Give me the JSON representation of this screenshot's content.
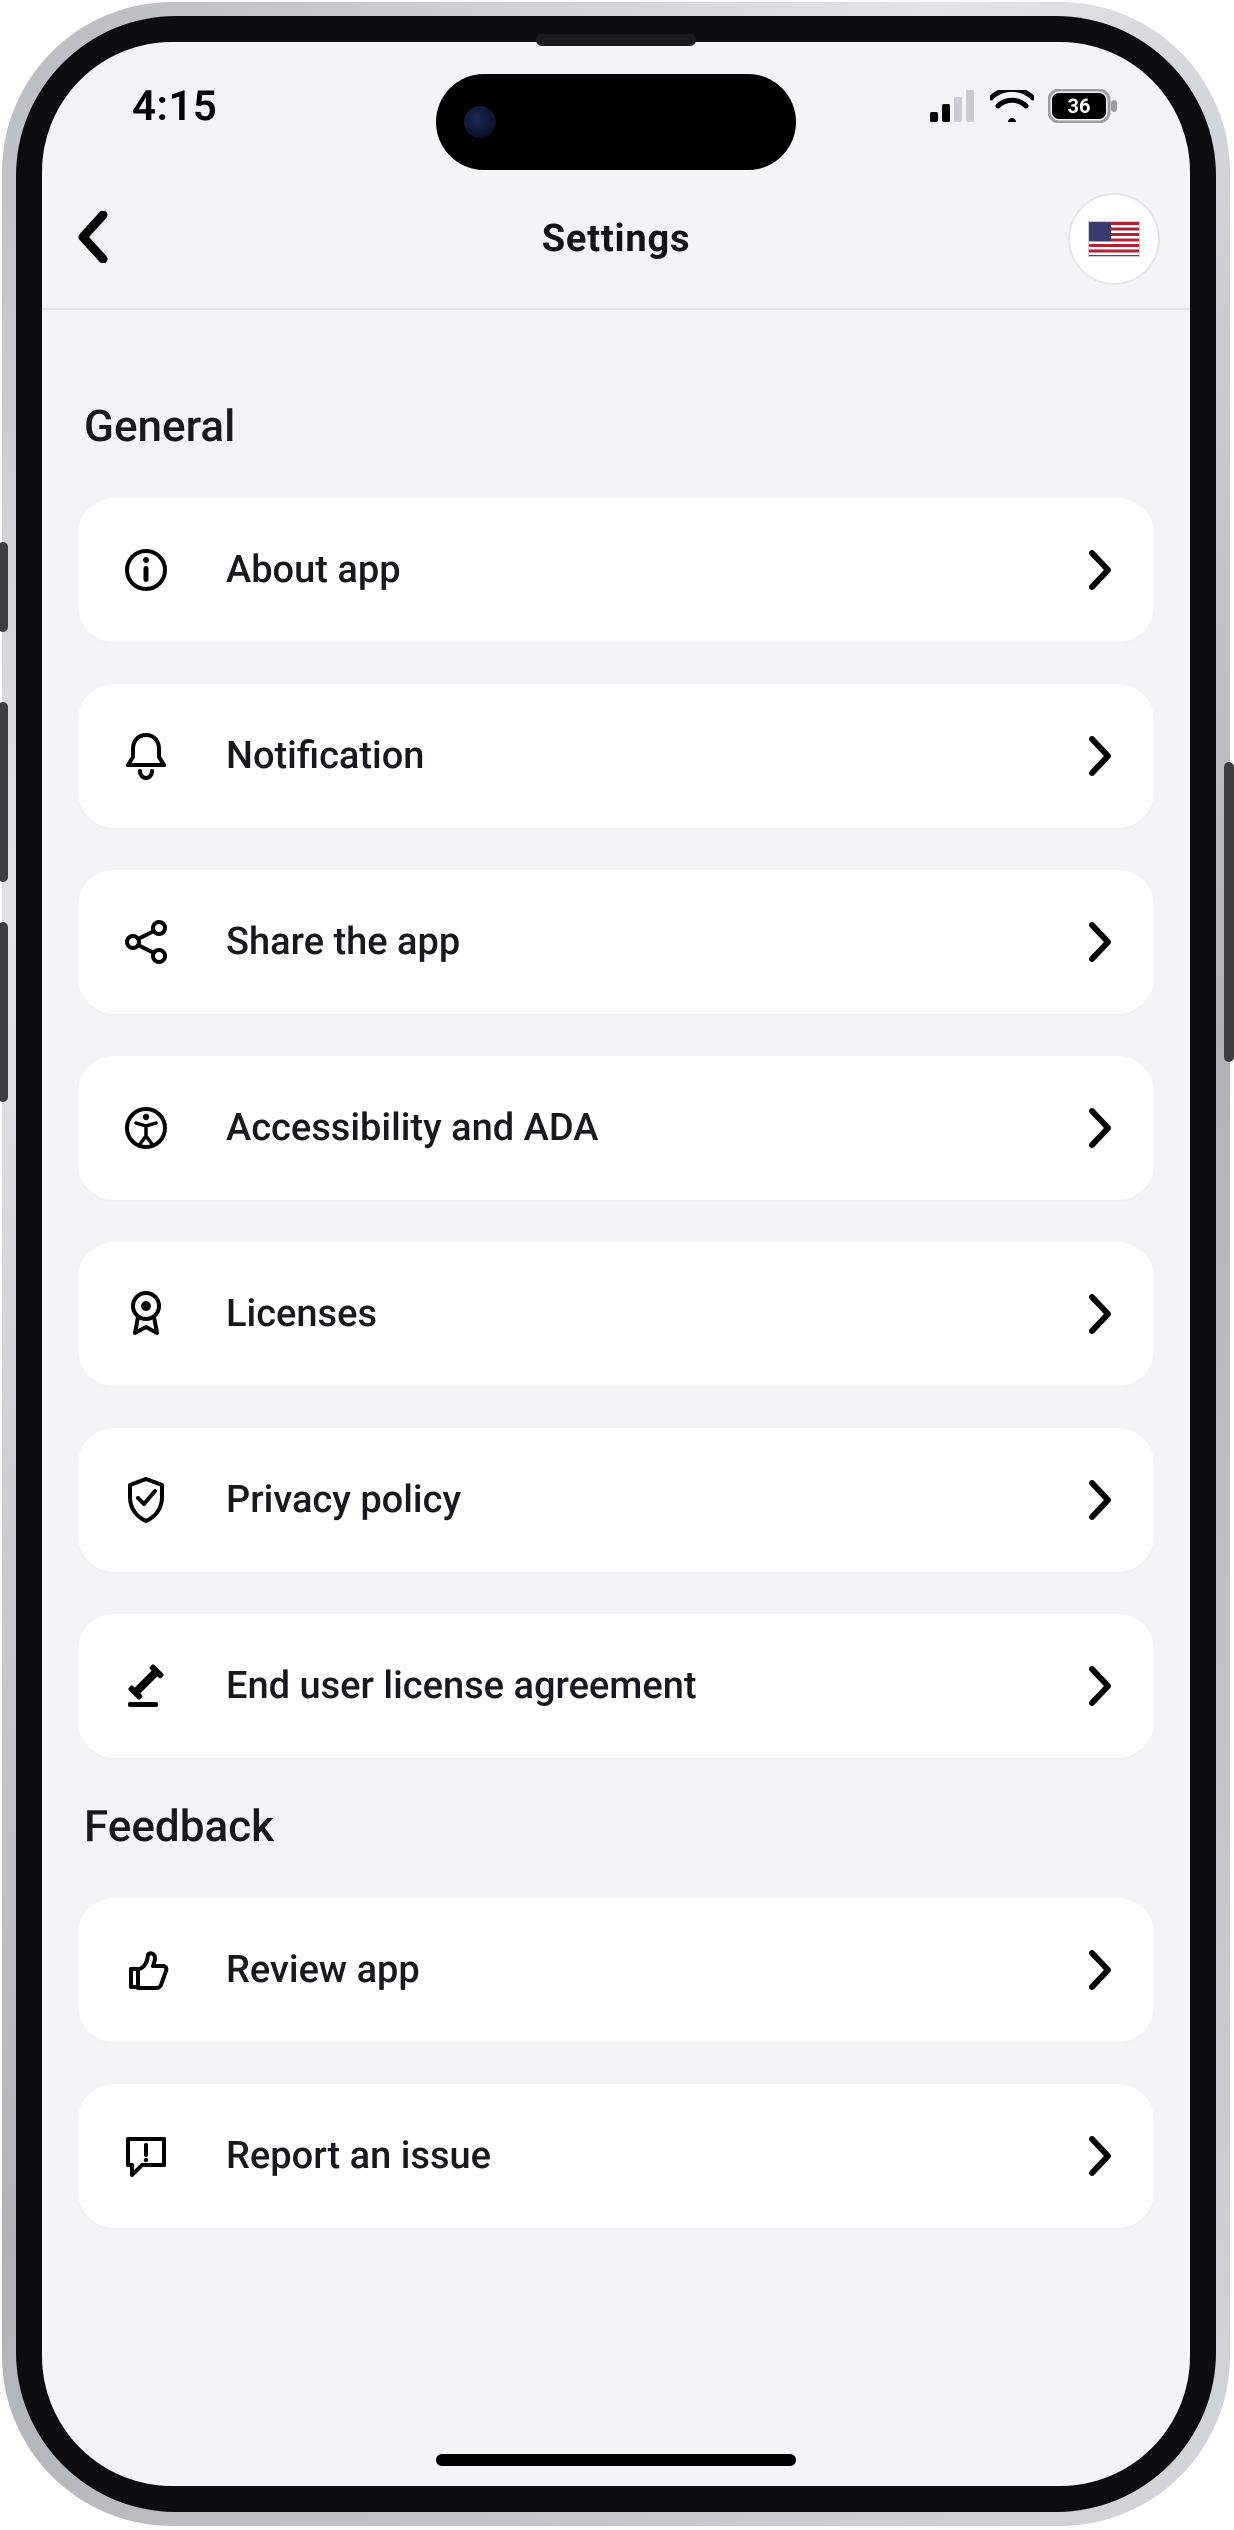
{
  "status": {
    "time": "4:15",
    "battery_percent": "36"
  },
  "header": {
    "title": "Settings",
    "flag": "us"
  },
  "sections": [
    {
      "title": "General",
      "items": [
        {
          "id": "about",
          "label": "About app",
          "icon": "info-icon"
        },
        {
          "id": "notif",
          "label": "Notification",
          "icon": "bell-icon"
        },
        {
          "id": "share",
          "label": "Share the app",
          "icon": "share-icon"
        },
        {
          "id": "access",
          "label": "Accessibility and ADA",
          "icon": "accessibility-icon"
        },
        {
          "id": "license",
          "label": "Licenses",
          "icon": "badge-icon"
        },
        {
          "id": "privacy",
          "label": "Privacy policy",
          "icon": "shield-check-icon"
        },
        {
          "id": "eula",
          "label": "End user license agreement",
          "icon": "gavel-icon"
        }
      ]
    },
    {
      "title": "Feedback",
      "items": [
        {
          "id": "review",
          "label": "Review app",
          "icon": "thumbs-up-icon"
        },
        {
          "id": "report",
          "label": "Report an issue",
          "icon": "chat-alert-icon"
        }
      ]
    }
  ]
}
